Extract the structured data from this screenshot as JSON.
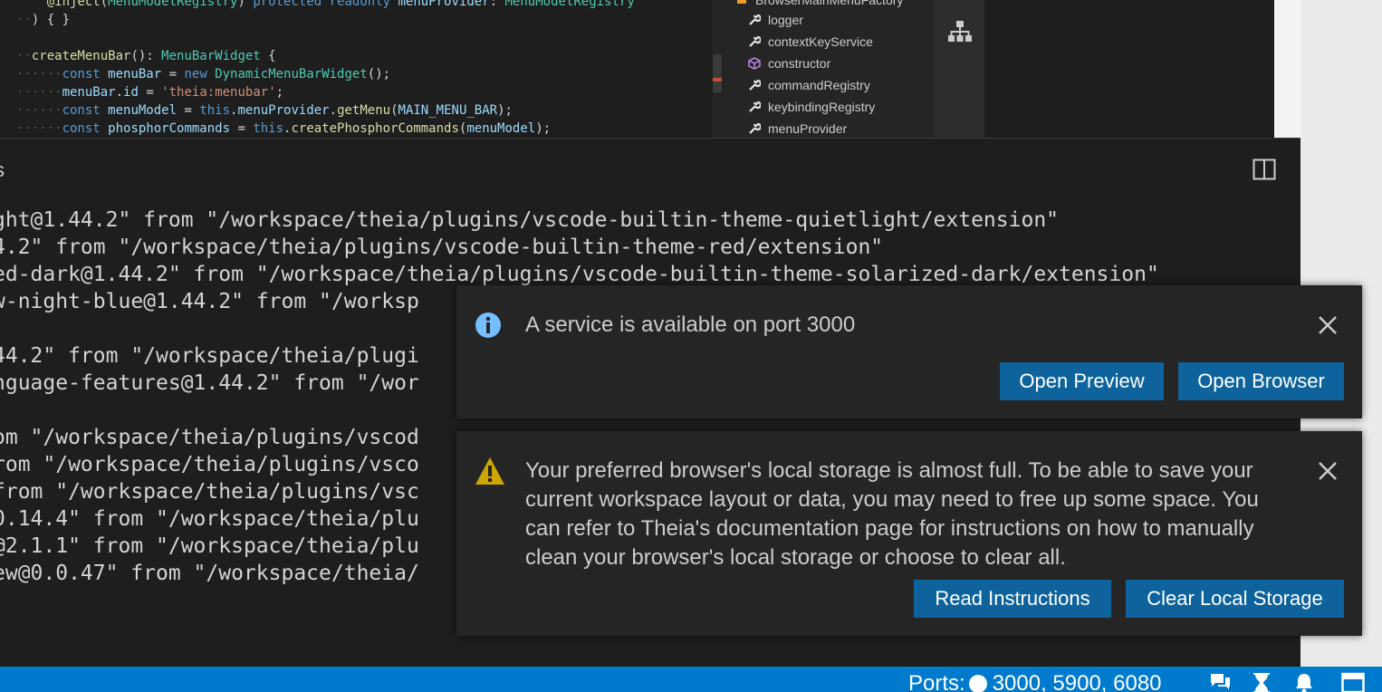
{
  "editor": {
    "lines": [
      {
        "tokens": [
          [
            "dots",
            "    "
          ],
          [
            "fn",
            "@inject"
          ],
          [
            "pl",
            "("
          ],
          [
            "ty",
            "MenuModelRegistry"
          ],
          [
            "pl",
            ") "
          ],
          [
            "kw",
            "protected readonly "
          ],
          [
            "var",
            "menuProvider"
          ],
          [
            "pl",
            ": "
          ],
          [
            "ty",
            "MenuModelRegistry"
          ]
        ]
      },
      {
        "tokens": [
          [
            "dots",
            "··"
          ],
          [
            "pl",
            ") { }"
          ]
        ]
      },
      {
        "tokens": [
          [
            "pl",
            ""
          ]
        ]
      },
      {
        "tokens": [
          [
            "dots",
            "··"
          ],
          [
            "fn",
            "createMenuBar"
          ],
          [
            "pl",
            "(): "
          ],
          [
            "ty",
            "MenuBarWidget"
          ],
          [
            "pl",
            " {"
          ]
        ]
      },
      {
        "tokens": [
          [
            "dots",
            "······"
          ],
          [
            "kw",
            "const "
          ],
          [
            "var",
            "menuBar"
          ],
          [
            "pl",
            " = "
          ],
          [
            "kw",
            "new "
          ],
          [
            "ty",
            "DynamicMenuBarWidget"
          ],
          [
            "pl",
            "();"
          ]
        ]
      },
      {
        "tokens": [
          [
            "dots",
            "······"
          ],
          [
            "var",
            "menuBar"
          ],
          [
            "pl",
            "."
          ],
          [
            "var",
            "id"
          ],
          [
            "pl",
            " = "
          ],
          [
            "str",
            "'theia:menubar'"
          ],
          [
            "pl",
            ";"
          ]
        ]
      },
      {
        "tokens": [
          [
            "dots",
            "······"
          ],
          [
            "kw",
            "const "
          ],
          [
            "var",
            "menuModel"
          ],
          [
            "pl",
            " = "
          ],
          [
            "kw",
            "this"
          ],
          [
            "pl",
            "."
          ],
          [
            "var",
            "menuProvider"
          ],
          [
            "pl",
            "."
          ],
          [
            "fn",
            "getMenu"
          ],
          [
            "pl",
            "("
          ],
          [
            "var",
            "MAIN_MENU_BAR"
          ],
          [
            "pl",
            ");"
          ]
        ]
      },
      {
        "tokens": [
          [
            "dots",
            "······"
          ],
          [
            "kw",
            "const "
          ],
          [
            "var",
            "phosphorCommands"
          ],
          [
            "pl",
            " = "
          ],
          [
            "kw",
            "this"
          ],
          [
            "pl",
            "."
          ],
          [
            "fn",
            "createPhosphorCommands"
          ],
          [
            "pl",
            "("
          ],
          [
            "var",
            "menuModel"
          ],
          [
            "pl",
            ");"
          ]
        ]
      }
    ]
  },
  "outline": {
    "items": [
      {
        "label": "BrowserMainMenuFactory",
        "icon": "class-icon"
      },
      {
        "label": "logger",
        "icon": "wrench-icon"
      },
      {
        "label": "contextKeyService",
        "icon": "wrench-icon"
      },
      {
        "label": "constructor",
        "icon": "cube-icon"
      },
      {
        "label": "commandRegistry",
        "icon": "wrench-icon"
      },
      {
        "label": "keybindingRegistry",
        "icon": "wrench-icon"
      },
      {
        "label": "menuProvider",
        "icon": "wrench-icon"
      }
    ]
  },
  "panel": {
    "title": "s",
    "lines": [
      "ght@1.44.2\" from \"/workspace/theia/plugins/vscode-builtin-theme-quietlight/extension\"",
      "4.2\" from \"/workspace/theia/plugins/vscode-builtin-theme-red/extension\"",
      "ed-dark@1.44.2\" from \"/workspace/theia/plugins/vscode-builtin-theme-solarized-dark/extension\"",
      "w-night-blue@1.44.2\" from \"/worksp",
      "",
      "44.2\" from \"/workspace/theia/plugi",
      "nguage-features@1.44.2\" from \"/wor",
      "",
      "om \"/workspace/theia/plugins/vscod",
      "rom \"/workspace/theia/plugins/vsco",
      "from \"/workspace/theia/plugins/vsc",
      "0.14.4\" from \"/workspace/theia/plu",
      "@2.1.1\" from \"/workspace/theia/plu",
      "ew@0.0.47\" from \"/workspace/theia/"
    ]
  },
  "notifications": {
    "service": {
      "message": "A service is available on port 3000",
      "buttons": [
        "Open Preview",
        "Open Browser"
      ]
    },
    "storage": {
      "message": "Your preferred browser's local storage is almost full. To be able to save your current workspace layout or data, you may need to free up some space. You can refer to Theia's documentation page for instructions on how to manually clean your browser's local storage or choose to clear all.",
      "buttons": [
        "Read Instructions",
        "Clear Local Storage"
      ]
    }
  },
  "statusbar": {
    "ports_label": "Ports:",
    "ports_value": "3000, 5900, 6080"
  },
  "colors": {
    "accent": "#007acc",
    "button": "#0e639c",
    "info": "#75beff",
    "warning": "#cca700"
  }
}
